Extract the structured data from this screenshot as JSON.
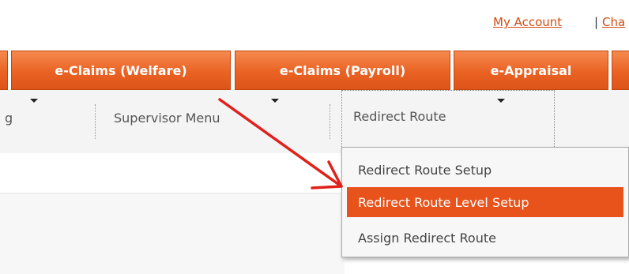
{
  "top_links": {
    "my_account": "My Account",
    "separator": "|",
    "cha": "Cha"
  },
  "tabs": [
    {
      "label": "e-Claims (Welfare)"
    },
    {
      "label": "e-Claims (Payroll)"
    },
    {
      "label": "e-Appraisal"
    }
  ],
  "submenu": {
    "partial_label": "g",
    "supervisor_label": "Supervisor Menu",
    "redirect_label": "Redirect Route"
  },
  "dropdown": {
    "items": [
      {
        "label": "Redirect Route Setup"
      },
      {
        "label": "Redirect Route Level Setup"
      },
      {
        "label": "Assign Redirect Route"
      }
    ]
  },
  "colors": {
    "accent": "#e8531c",
    "link": "#d34c12",
    "arrow": "#e0201b"
  }
}
